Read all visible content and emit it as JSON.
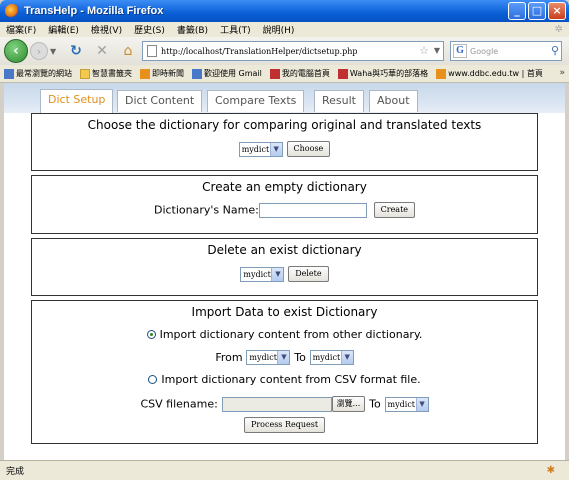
{
  "window": {
    "title": "TransHelp - Mozilla Firefox",
    "minimize": "_",
    "maximize": "□",
    "close": "×"
  },
  "menu": [
    "檔案(F)",
    "編輯(E)",
    "檢視(V)",
    "歷史(S)",
    "書籤(B)",
    "工具(T)",
    "說明(H)"
  ],
  "nav": {
    "url": "http://localhost/TranslationHelper/dictsetup.php",
    "search_placeholder": "Google"
  },
  "bookmarks": [
    {
      "label": "最常瀏覽的網站",
      "icon": "blue"
    },
    {
      "label": "智慧書籤夾",
      "icon": "folder"
    },
    {
      "label": "即時新聞",
      "icon": "orange"
    },
    {
      "label": "歡迎使用 Gmail",
      "icon": "blue"
    },
    {
      "label": "我的電腦首頁",
      "icon": "red"
    },
    {
      "label": "Waha與巧華的部落格",
      "icon": "red"
    },
    {
      "label": "www.ddbc.edu.tw | 首頁",
      "icon": "orange"
    }
  ],
  "tabs": [
    "Dict Setup",
    "Dict Content",
    "Compare Texts",
    "Result",
    "About"
  ],
  "active_tab": "Dict Setup",
  "sections": {
    "choose": {
      "title": "Choose the dictionary for comparing original and translated texts",
      "select_value": "mydict",
      "button": "Choose"
    },
    "create": {
      "title": "Create an empty dictionary",
      "name_label": "Dictionary's Name:",
      "name_value": "",
      "button": "Create"
    },
    "delete": {
      "title": "Delete an exist dictionary",
      "select_value": "mydict",
      "button": "Delete"
    },
    "import": {
      "title": "Import Data to exist Dictionary",
      "option1": "Import dictionary content from other dictionary.",
      "from_label": "From",
      "from_value": "mydict",
      "to_label": "To",
      "to_value": "mydict",
      "option2": "Import dictionary content from CSV format file.",
      "csv_label": "CSV filename:",
      "browse_button": "瀏覽...",
      "to_label2": "To",
      "to_value2": "mydict",
      "process_button": "Process Request"
    }
  },
  "status": "完成",
  "colors": {
    "active_tab": "#e09018",
    "titlebar": "#0a5fd6"
  }
}
